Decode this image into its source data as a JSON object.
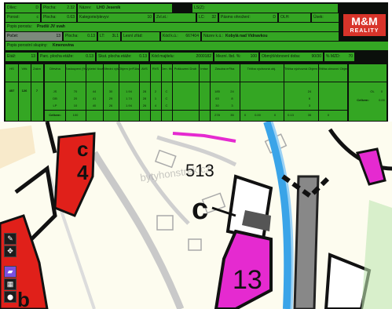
{
  "header": {
    "dilec_label": "Dílec:",
    "dilec_value": "D",
    "plocha_label": "Plocha:",
    "plocha_value": "2.32",
    "nazev_label": "Název:",
    "nazev_value": "LHO Jeseník",
    "ls_label": "LS(Z):",
    "ls_value": "",
    "porost_label": "Porost:",
    "porost_value": "c",
    "plocha2_label": "Plocha:",
    "plocha2_value": "0.63",
    "kategorie_label": "Kategorie/plevyv:",
    "kategorie_value": "10",
    "zvl_label": "Zvl.st.:",
    "zvl_value": "",
    "lc_label": "LC:",
    "lc_value": "32",
    "pasmo_label": "Pásmo ohrožení:",
    "pasmo_value": "D",
    "olh_label": "OLH:",
    "olh_value": "",
    "usek_label": "Úsek:",
    "usek_value": "",
    "popis_porostu_label": "Popis porostu:",
    "popis_porostu_value": "Prudší JV svah",
    "pocet_label": "Počet:",
    "pocet_value": "13",
    "plocha3_label": "Plocha:",
    "plocha3_value": "0.13",
    "lt_label": "LT:",
    "lt_value": "3L1",
    "lesni_ukazatel_label": "Lesní zřád:",
    "lesni_ukazatel_value": "",
    "kod_ku_label": "Kód k.ú.:",
    "kod_ku_value": "667404",
    "nazev_ku_label": "Název k.ú.:",
    "nazev_ku_value": "Kobylá nad Vidnavkou",
    "popis_skupiny_label": "Popis porostní skupiny:",
    "popis_skupiny_value": "Kmenovina",
    "etaz_label": "Etáž:",
    "etaz_value": "13",
    "parc_plocha_label": "Parc. plocha etáže:",
    "parc_plocha_value": "0.13",
    "skut_plocha_label": "Skut. plocha etáže:",
    "skut_plocha_value": "0.13",
    "kod_majitelu_label": "Kód majitelu:",
    "kod_majitelu_value": "2000182",
    "mezni_label": "Mezní. lbd. %:",
    "mezni_value": "100",
    "obmyti_label": "Obmýtí/obnovní doba:",
    "obmyti_value": "90/30",
    "mzd_label": "% MZD:",
    "mzd_value": "70"
  },
  "logo": {
    "text": "M&M",
    "sub": "REALITY"
  },
  "etaz_table": {
    "headers": [
      "HS",
      "Věk",
      "Zakm"
    ],
    "values": [
      "457",
      "126",
      "7"
    ]
  },
  "species_table": {
    "headers": [
      "Dřevina",
      "Zastoupení (%)",
      "Výčetní tloušťka (cm)",
      "Střední výška (m)",
      "Objem (m³/1ks)",
      "AVS",
      "RVS",
      "Gen. třída",
      "Poškození Druh",
      "Poškození %",
      "Imise",
      "Zásoba m³/ha",
      "Zásoba Celkem",
      "Těžba výchovná obj.",
      "Těžba výchovná Plocha",
      "Těžba výchovná Naléh.",
      "Těžba výchovná Objem",
      "Těžba obnovní naléh.",
      "Těžba obnovní Plocha",
      "Těžba obnovní Objem",
      "Probírky naléh.",
      "Probírky Plocha",
      "Zákonné Dr.",
      "Zákonné Dřevina",
      "Zákonné Plocha"
    ],
    "rows": [
      {
        "species": "JS",
        "pct": "70",
        "d": "44",
        "h": "30",
        "vol": "1.94",
        "avs": "28",
        "rvs": "2",
        "gen": "C",
        "zasoba_ha": "185",
        "zasoba_total": "24",
        "tez_obn_obj": "24"
      },
      {
        "species": "DB",
        "pct": "20",
        "d": "41",
        "h": "29",
        "vol": "1.74",
        "avs": "28",
        "rvs": "1",
        "gen": "C",
        "zasoba_ha": "63",
        "zasoba_total": "8",
        "tez_obn_obj": "6"
      },
      {
        "species": "LP",
        "pct": "10",
        "d": "40",
        "h": "26",
        "vol": "1.94",
        "avs": "26",
        "rvs": "4",
        "gen": "C",
        "zasoba_ha": "30",
        "zasoba_total": "3",
        "tez_obn_obj": "3"
      }
    ],
    "total": {
      "label": "Celkem:",
      "pct": "100",
      "zasoba_ha": "278",
      "zasoba_total": "35",
      "a": "0",
      "b": "0.00",
      "c": "0",
      "d": "0.13",
      "e": "35",
      "f": "0"
    },
    "right_rows": [
      "OL",
      "Celkem:"
    ],
    "right_values": [
      "0",
      "0.00"
    ]
  },
  "map": {
    "labels": {
      "c4_top": "c",
      "c4_num": "4",
      "parcel": "513",
      "c_big": "c",
      "n13": "13",
      "b": "b"
    },
    "watermark": "bytyhonstrek.cz"
  },
  "toolbar": {
    "pencil": "✎",
    "move": "✥",
    "layers": "▰",
    "table": "▦",
    "pin": "⬤"
  },
  "colors": {
    "panel_bg": "#0b0f0b",
    "cell_green": "#34a623",
    "magenta": "#e52ad0",
    "red": "#e0201a"
  }
}
